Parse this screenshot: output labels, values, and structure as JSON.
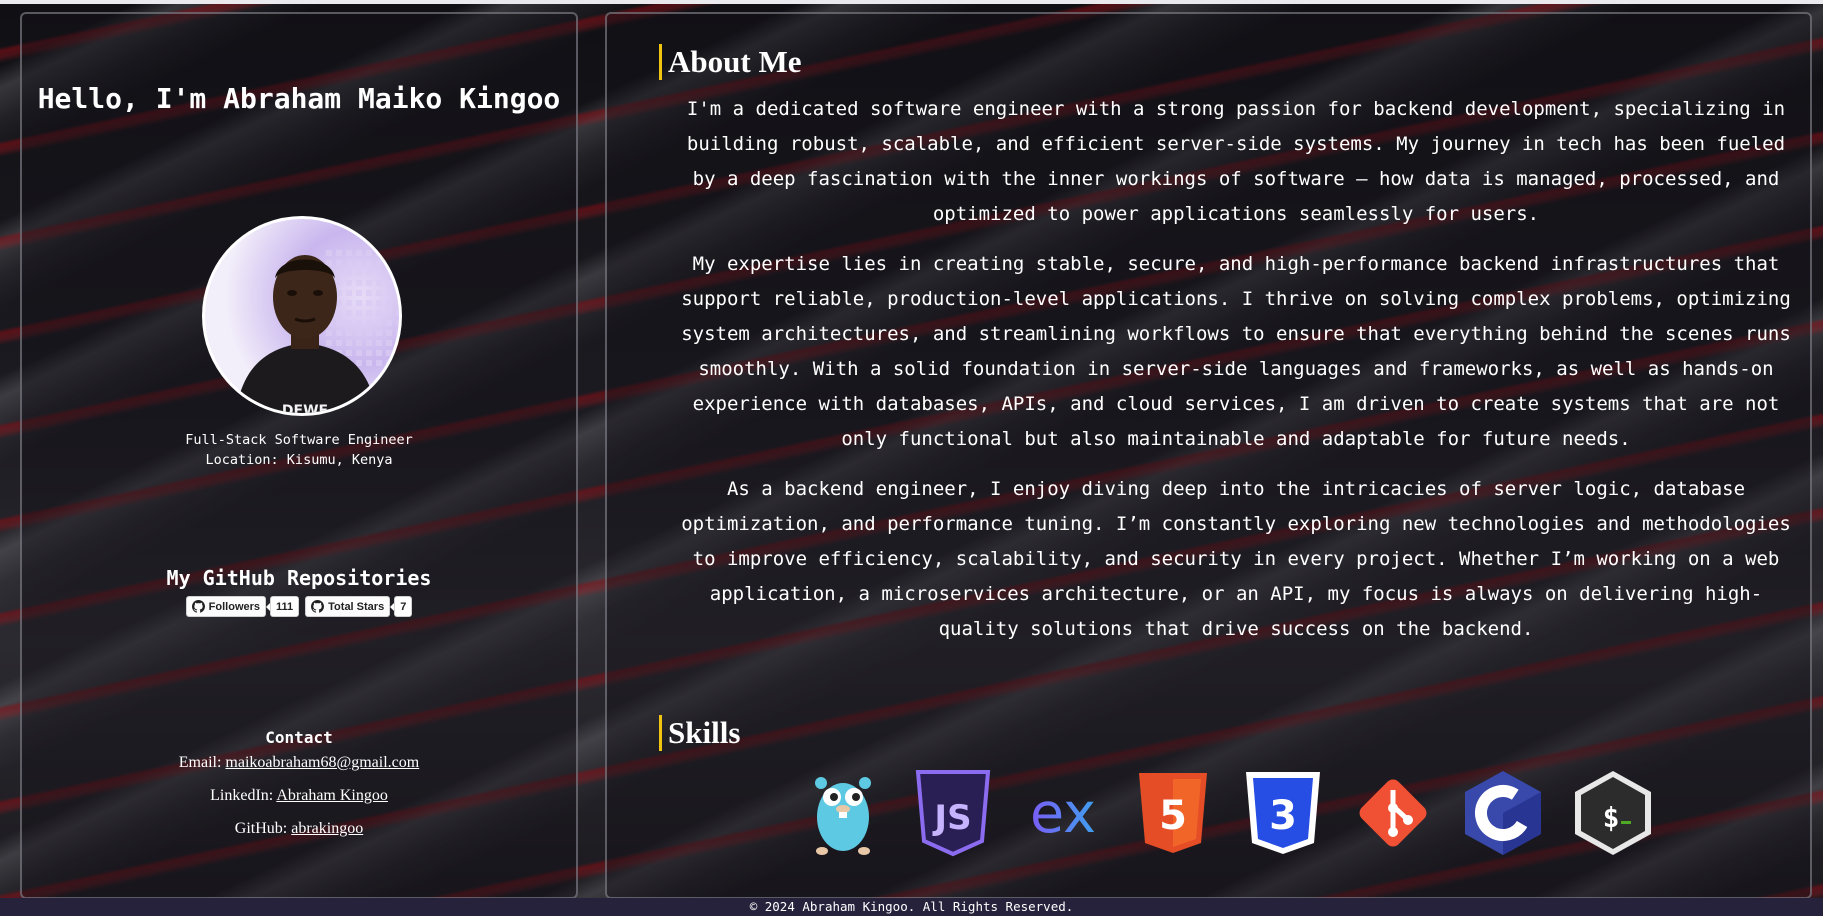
{
  "profile": {
    "greeting": "Hello, I'm Abraham Maiko Kingoo",
    "avatar_alt": "Profile photo",
    "role": "Full-Stack Software Engineer",
    "location": "Location: Kisumu, Kenya"
  },
  "github": {
    "title": "My GitHub Repositories",
    "followers_label": "Followers",
    "followers_count": "111",
    "stars_label": "Total Stars",
    "stars_count": "7"
  },
  "contact": {
    "title": "Contact",
    "email_label": "Email: ",
    "email": "maikoabraham68@gmail.com",
    "linkedin_label": "LinkedIn: ",
    "linkedin": "Abraham Kingoo",
    "github_label": "GitHub: ",
    "github": "abrakingoo"
  },
  "about": {
    "title": "About Me",
    "paragraphs": [
      "I'm a dedicated software engineer with a strong passion for backend development, specializing in building robust, scalable, and efficient server-side systems. My journey in tech has been fueled by a deep fascination with the inner workings of software — how data is managed, processed, and optimized to power applications seamlessly for users.",
      "My expertise lies in creating stable, secure, and high-performance backend infrastructures that support reliable, production-level applications. I thrive on solving complex problems, optimizing system architectures, and streamlining workflows to ensure that everything behind the scenes runs smoothly. With a solid foundation in server-side languages and frameworks, as well as hands-on experience with databases, APIs, and cloud services, I am driven to create systems that are not only functional but also maintainable and adaptable for future needs.",
      "As a backend engineer, I enjoy diving deep into the intricacies of server logic, database optimization, and performance tuning. I’m constantly exploring new technologies and methodologies to improve efficiency, scalability, and security in every project. Whether I’m working on a web application, a microservices architecture, or an API, my focus is always on delivering high-quality solutions that drive success on the backend."
    ]
  },
  "skills": {
    "title": "Skills",
    "icons": [
      "go-gopher-icon",
      "javascript-icon",
      "express-icon",
      "html5-icon",
      "css3-icon",
      "git-icon",
      "c-language-icon",
      "bash-icon"
    ],
    "colors": {
      "go": "#5dc9e2",
      "js": "#8b6cf0",
      "express": "#7a5cf5",
      "html5": "#e44d26",
      "css3": "#264de4",
      "git": "#f05033",
      "c": "#3949ab",
      "bash": "#2c2c2c"
    }
  },
  "footer": {
    "text": "© 2024 Abraham Kingoo. All Rights Reserved."
  },
  "theme": {
    "accent": "#f1c40f",
    "footer_bg": "#27223c"
  }
}
